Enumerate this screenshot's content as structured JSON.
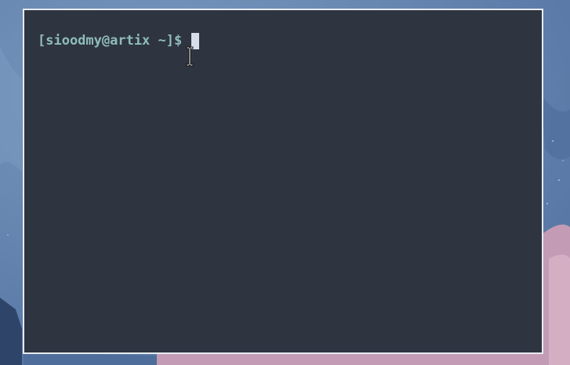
{
  "desktop": {
    "wallpaper_colors": {
      "sky": "#6384b0",
      "sky_light": "#7a9ac0",
      "sky_dark": "#4f6d9a",
      "blossom": "#c49bb5",
      "blossom_light": "#dcb8cb",
      "ground_dark": "#2f4469"
    }
  },
  "terminal": {
    "background": "#2e3440",
    "border": "#e6ebf2",
    "prompt_color": "#8fbcbb",
    "cursor_color": "#d8dee9",
    "prompt": "[sioodmy@artix ~]$",
    "input": ""
  },
  "mouse": {
    "cursor": "ibeam-cursor-icon"
  }
}
